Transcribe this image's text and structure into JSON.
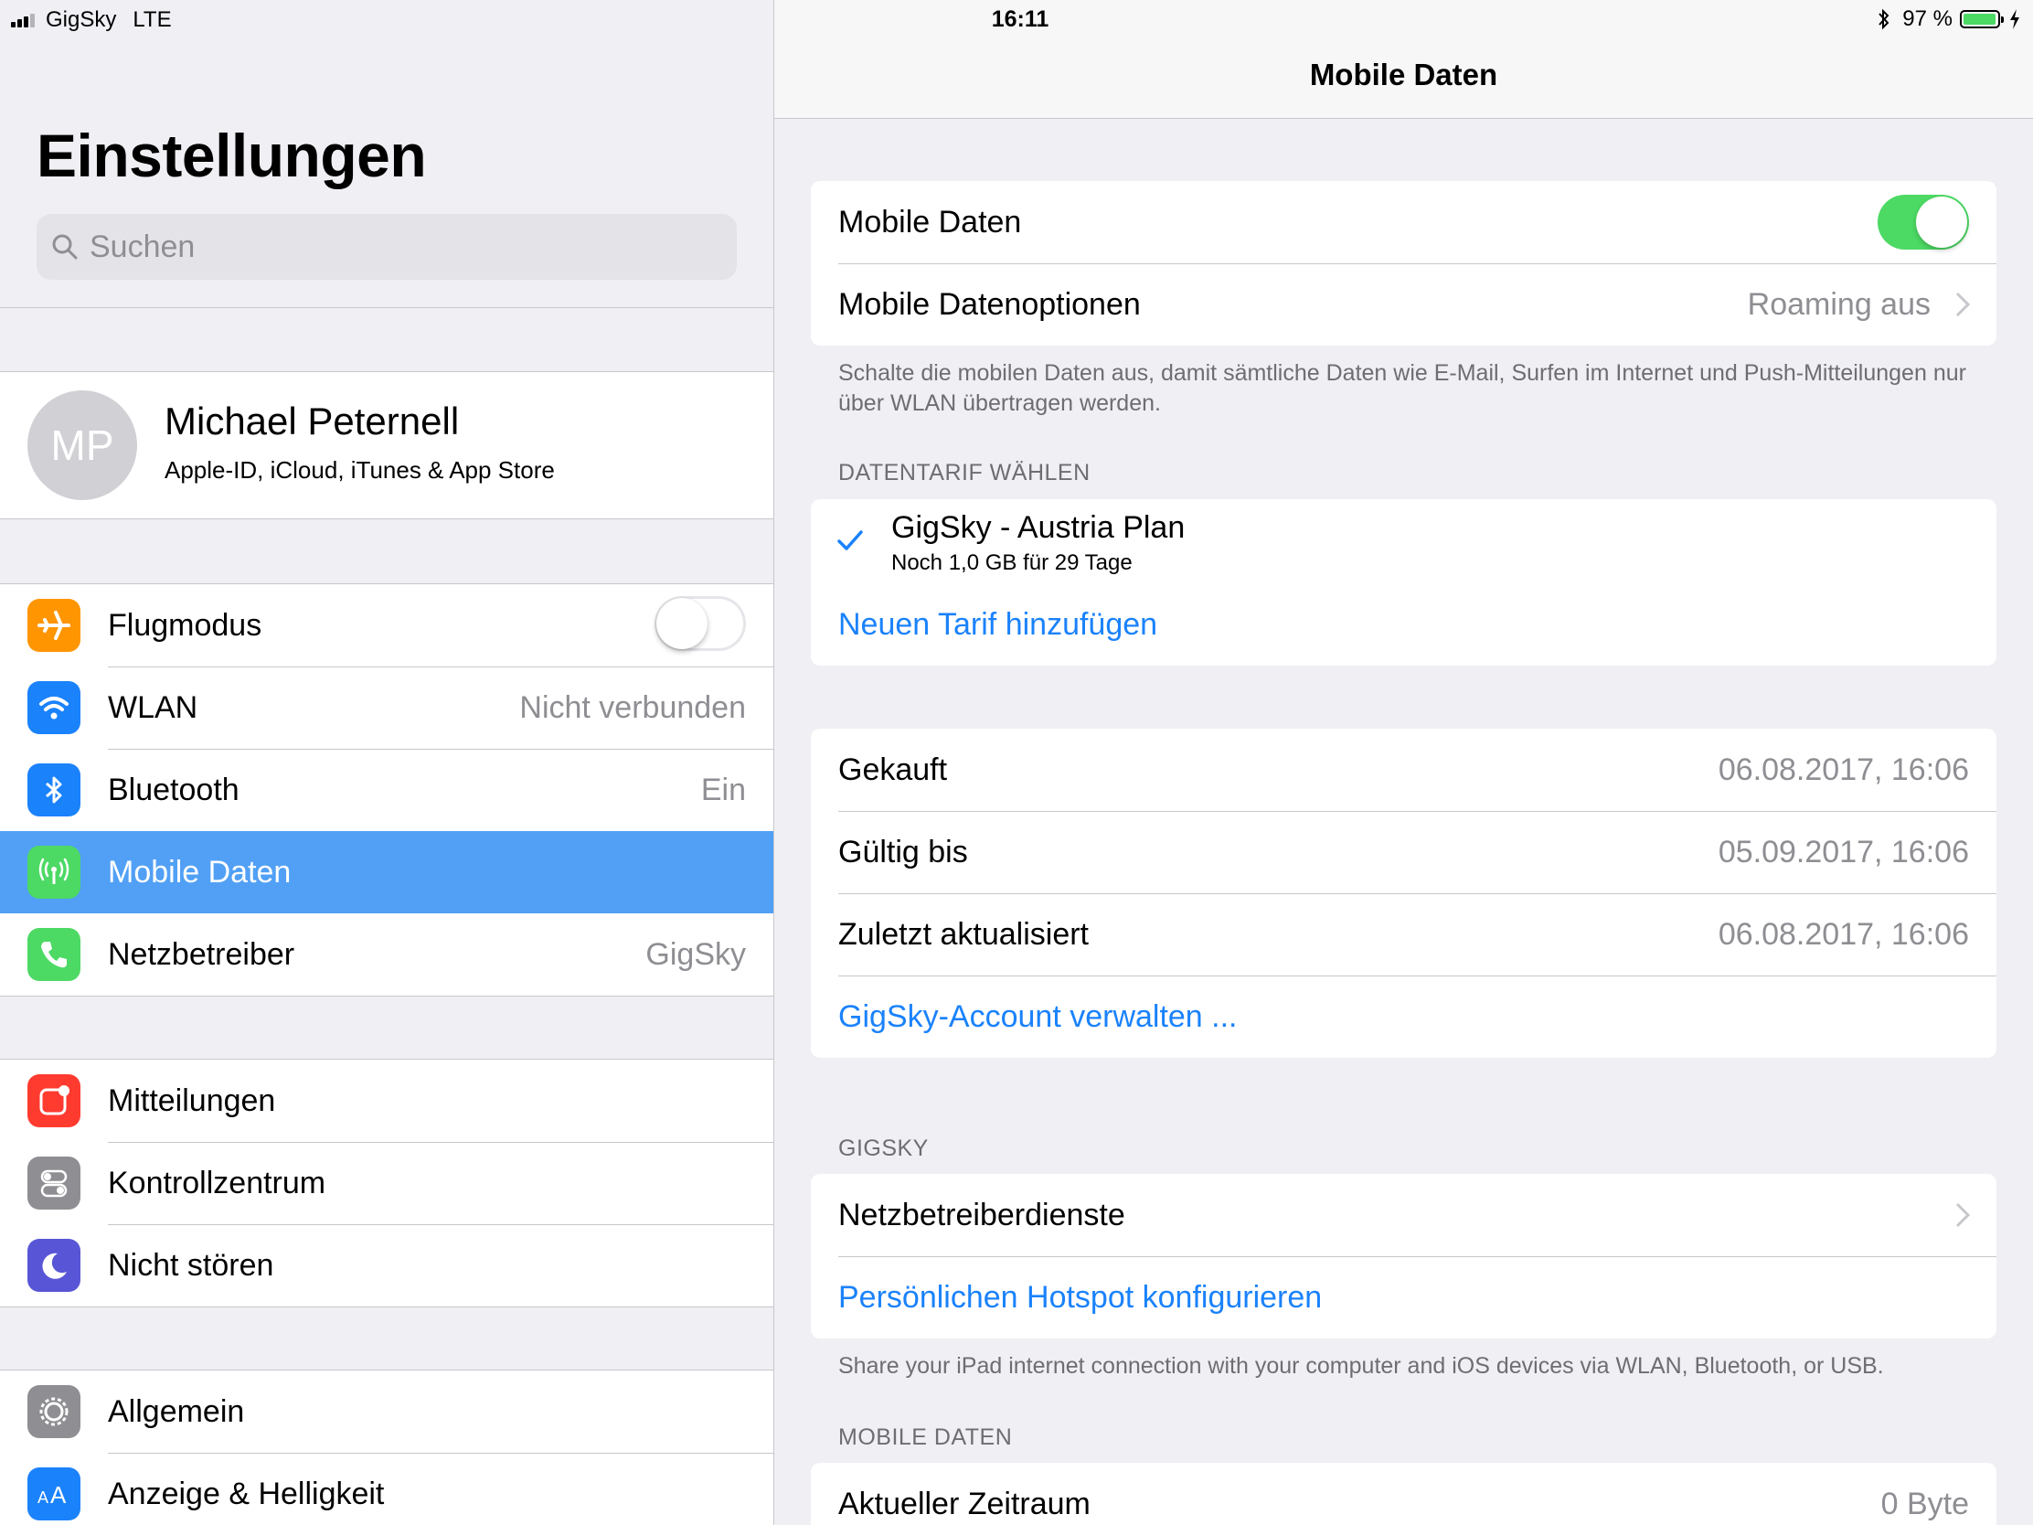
{
  "status_bar": {
    "carrier": "GigSky",
    "network": "LTE",
    "time": "16:11",
    "battery_label": "97 %",
    "battery_level": 0.97
  },
  "master": {
    "title": "Einstellungen",
    "search_placeholder": "Suchen",
    "profile": {
      "initials": "MP",
      "name": "Michael Peternell",
      "subtitle": "Apple-ID, iCloud, iTunes & App Store"
    },
    "groups": [
      [
        {
          "label": "Flugmodus",
          "icon": "airplane-icon",
          "color": "#ff9500",
          "toggle": false
        },
        {
          "label": "WLAN",
          "icon": "wifi-icon",
          "color": "#1a82fb",
          "value": "Nicht verbunden"
        },
        {
          "label": "Bluetooth",
          "icon": "bluetooth-icon",
          "color": "#1a82fb",
          "value": "Ein"
        },
        {
          "label": "Mobile Daten",
          "icon": "antenna-icon",
          "color": "#4cd964",
          "selected": true
        },
        {
          "label": "Netzbetreiber",
          "icon": "phone-icon",
          "color": "#4cd964",
          "value": "GigSky"
        }
      ],
      [
        {
          "label": "Mitteilungen",
          "icon": "notifications-icon",
          "color": "#ff3b30"
        },
        {
          "label": "Kontrollzentrum",
          "icon": "control-center-icon",
          "color": "#8e8e93"
        },
        {
          "label": "Nicht stören",
          "icon": "moon-icon",
          "color": "#5856d6"
        }
      ],
      [
        {
          "label": "Allgemein",
          "icon": "gear-icon",
          "color": "#8e8e93"
        },
        {
          "label": "Anzeige & Helligkeit",
          "icon": "text-size-icon",
          "color": "#1a82fb"
        }
      ]
    ]
  },
  "detail": {
    "nav_title": "Mobile Daten",
    "cellular": {
      "label": "Mobile Daten",
      "enabled": true,
      "options_label": "Mobile Datenoptionen",
      "options_value": "Roaming aus"
    },
    "cellular_footer": "Schalte die mobilen Daten aus, damit sämtliche Daten wie E-Mail, Surfen im Internet und Push-Mitteilungen nur über WLAN übertragen werden.",
    "plan_header": "DATENTARIF WÄHLEN",
    "plan": {
      "name": "GigSky - Austria Plan",
      "remaining": "Noch 1,0 GB für 29 Tage",
      "add_plan": "Neuen Tarif hinzufügen"
    },
    "plan_details": [
      {
        "label": "Gekauft",
        "value": "06.08.2017, 16:06"
      },
      {
        "label": "Gültig bis",
        "value": "05.09.2017, 16:06"
      },
      {
        "label": "Zuletzt aktualisiert",
        "value": "06.08.2017, 16:06"
      }
    ],
    "manage_account": "GigSky-Account verwalten ...",
    "gigsky_header": "GIGSKY",
    "carrier_services": "Netzbetreiberdienste",
    "hotspot": "Persönlichen Hotspot konfigurieren",
    "hotspot_footer": "Share your iPad internet connection with your computer and iOS devices via WLAN, Bluetooth, or USB.",
    "usage_header": "MOBILE DATEN",
    "current_period": {
      "label": "Aktueller Zeitraum",
      "value": "0 Byte"
    }
  }
}
